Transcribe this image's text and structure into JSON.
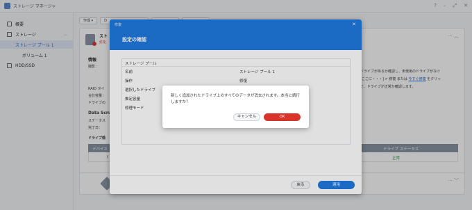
{
  "window": {
    "title": "ストレージ マネージャ",
    "controls": [
      "?",
      "–",
      "⤢",
      "✕"
    ]
  },
  "sidebar": {
    "items": [
      {
        "label": "概要"
      },
      {
        "label": "ストレージ"
      },
      {
        "label": "ストレージ プール 1"
      },
      {
        "label": "ボリューム 1"
      },
      {
        "label": "HDD/SSD"
      }
    ]
  },
  "toolbar": {
    "buttons": [
      "作成 ▾",
      "D",
      "",
      ""
    ]
  },
  "pool_card": {
    "name": "スト",
    "status": "劣化",
    "info_heading": "情報",
    "labels": [
      "撮影：",
      "RAID タイ",
      "合計容量：",
      "ドライブの",
      "Data Scru",
      "ステータス",
      "完了日："
    ],
    "drive_info_heading": "ドライブ情",
    "right_text_1": "ドライブがあるか確認し、未使用のドライブがなけ",
    "right_text_2a": "[ここに・・・] > ",
    "right_text_2b": "修復",
    "right_text_2c": " または ",
    "right_text_2link": "今すぐ修復",
    "right_text_2d": " をクリッ",
    "right_text_3": "て、ドライブが正常か確認します。",
    "table_col_device": "デバイス",
    "table_col_status": "ドライブ ステータス",
    "table_status_value": "正常",
    "table_cell_partial": "("
  },
  "wizard": {
    "small_title": "修復",
    "title": "設定の確認",
    "section": "ストレージ プール",
    "rows": [
      {
        "label": "名前",
        "value": "ストレージ プール 1"
      },
      {
        "label": "操作",
        "value": "修復"
      },
      {
        "label": "選択したドライブ",
        "value": ""
      },
      {
        "label": "推定容量",
        "value": ""
      },
      {
        "label": "修理モード",
        "value": ""
      }
    ],
    "back_label": "戻る",
    "apply_label": "適用"
  },
  "confirm": {
    "message": "新しく追加されたドライブ上のすべてのデータが消去されます。本当に続行しますか？",
    "cancel_label": "キャンセル",
    "ok_label": "OK"
  },
  "colors": {
    "primary": "#1f7ae0",
    "danger": "#d9342b",
    "link": "#2c6ac7",
    "success": "#2e9e4f"
  }
}
